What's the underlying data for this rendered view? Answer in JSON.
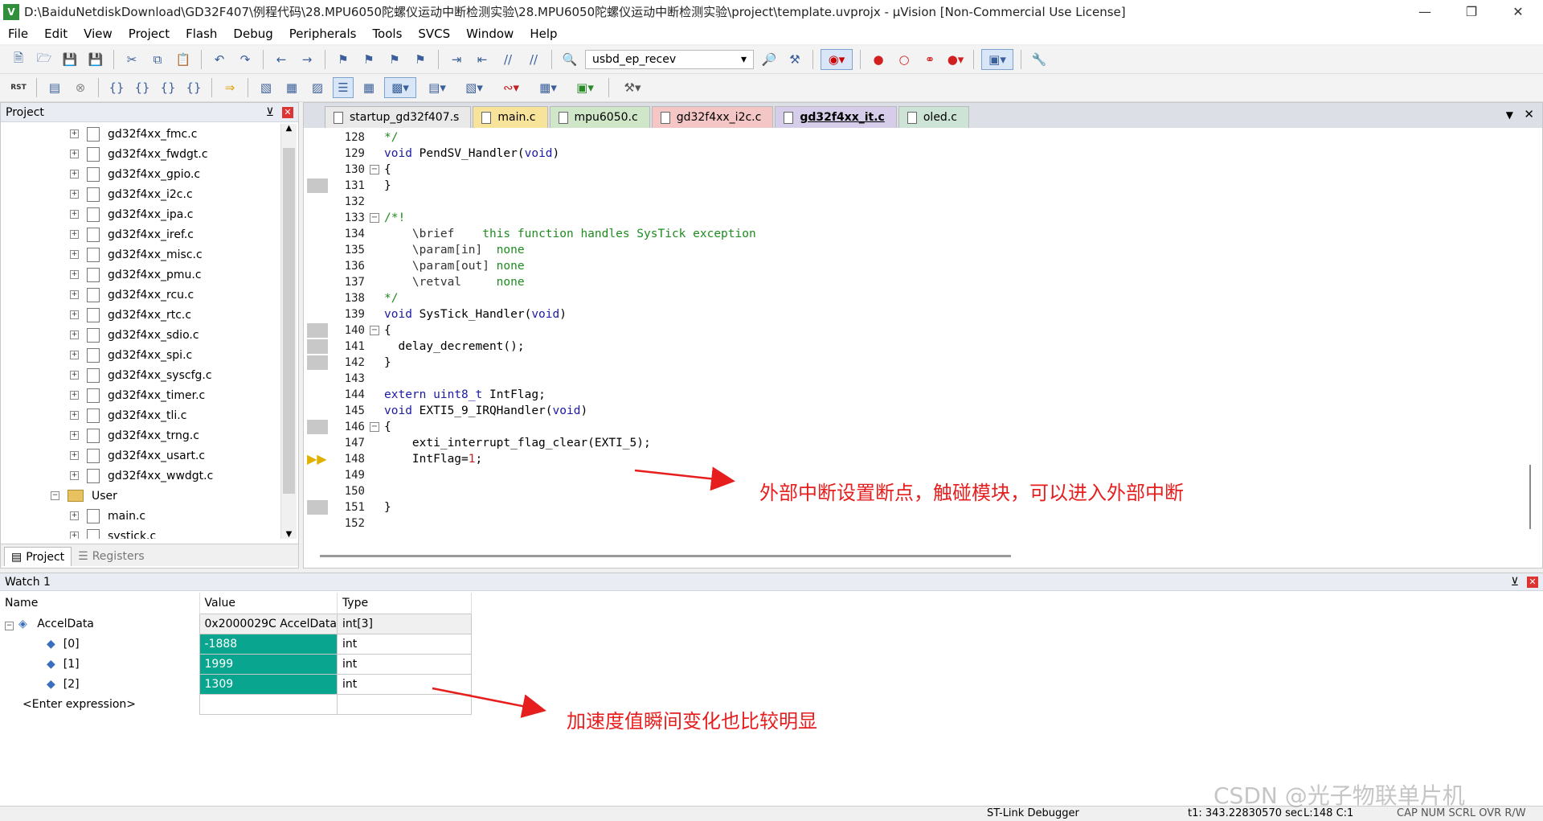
{
  "window": {
    "title": "D:\\BaiduNetdiskDownload\\GD32F407\\例程代码\\28.MPU6050陀螺仪运动中断检测实验\\28.MPU6050陀螺仪运动中断检测实验\\project\\template.uvprojx - µVision  [Non-Commercial Use License]",
    "logo": "V"
  },
  "menu": [
    "File",
    "Edit",
    "View",
    "Project",
    "Flash",
    "Debug",
    "Peripherals",
    "Tools",
    "SVCS",
    "Window",
    "Help"
  ],
  "toolbar": {
    "target_combo": "usbd_ep_recev",
    "rst_label": "RST"
  },
  "project_panel": {
    "title": "Project",
    "files": [
      "gd32f4xx_fmc.c",
      "gd32f4xx_fwdgt.c",
      "gd32f4xx_gpio.c",
      "gd32f4xx_i2c.c",
      "gd32f4xx_ipa.c",
      "gd32f4xx_iref.c",
      "gd32f4xx_misc.c",
      "gd32f4xx_pmu.c",
      "gd32f4xx_rcu.c",
      "gd32f4xx_rtc.c",
      "gd32f4xx_sdio.c",
      "gd32f4xx_spi.c",
      "gd32f4xx_syscfg.c",
      "gd32f4xx_timer.c",
      "gd32f4xx_tli.c",
      "gd32f4xx_trng.c",
      "gd32f4xx_usart.c",
      "gd32f4xx_wwdgt.c"
    ],
    "folder": "User",
    "user_files": [
      "main.c",
      "systick.c"
    ],
    "tabs": [
      "Project",
      "Registers"
    ]
  },
  "editor": {
    "tabs": [
      {
        "label": "startup_gd32f407.s",
        "color": "#e9e9e9"
      },
      {
        "label": "main.c",
        "color": "#f7e39a"
      },
      {
        "label": "mpu6050.c",
        "color": "#cfe6c8"
      },
      {
        "label": "gd32f4xx_i2c.c",
        "color": "#f4c6c6"
      },
      {
        "label": "gd32f4xx_it.c",
        "color": "#d6cdea"
      },
      {
        "label": "oled.c",
        "color": "#cce3d6"
      }
    ],
    "active_tab": "gd32f4xx_it.c",
    "lines": [
      {
        "n": "128",
        "t": "*/"
      },
      {
        "n": "129",
        "t": "void PendSV_Handler(void)"
      },
      {
        "n": "130",
        "t": "{"
      },
      {
        "n": "131",
        "t": "}"
      },
      {
        "n": "132",
        "t": ""
      },
      {
        "n": "133",
        "t": "/*!"
      },
      {
        "n": "134",
        "t": "    \\brief    this function handles SysTick exception"
      },
      {
        "n": "135",
        "t": "    \\param[in]  none"
      },
      {
        "n": "136",
        "t": "    \\param[out] none"
      },
      {
        "n": "137",
        "t": "    \\retval     none"
      },
      {
        "n": "138",
        "t": "*/"
      },
      {
        "n": "139",
        "t": "void SysTick_Handler(void)"
      },
      {
        "n": "140",
        "t": "{"
      },
      {
        "n": "141",
        "t": "  delay_decrement();"
      },
      {
        "n": "142",
        "t": "}"
      },
      {
        "n": "143",
        "t": ""
      },
      {
        "n": "144",
        "t": "extern uint8_t IntFlag;"
      },
      {
        "n": "145",
        "t": "void EXTI5_9_IRQHandler(void)"
      },
      {
        "n": "146",
        "t": "{"
      },
      {
        "n": "147",
        "t": "    exti_interrupt_flag_clear(EXTI_5);"
      },
      {
        "n": "148",
        "t": "    IntFlag=1;"
      },
      {
        "n": "149",
        "t": ""
      },
      {
        "n": "150",
        "t": ""
      },
      {
        "n": "151",
        "t": "}"
      },
      {
        "n": "152",
        "t": ""
      }
    ]
  },
  "watch": {
    "title": "Watch 1",
    "columns": [
      "Name",
      "Value",
      "Type"
    ],
    "rows": [
      {
        "name": "AccelData",
        "value": "0x2000029C AccelData",
        "type": "int[3]"
      },
      {
        "name": "[0]",
        "value": "-1888",
        "type": "int"
      },
      {
        "name": "[1]",
        "value": "1999",
        "type": "int"
      },
      {
        "name": "[2]",
        "value": "1309",
        "type": "int"
      }
    ],
    "enter_expression": "<Enter expression>"
  },
  "annotations": {
    "breakpoint_note": "外部中断设置断点，触碰模块，可以进入外部中断",
    "accel_note": "加速度值瞬间变化也比较明显",
    "color": "#e61e1e"
  },
  "status": {
    "debugger": "ST-Link Debugger",
    "time": "t1: 343.22830570 sec",
    "position": "L:148 C:1",
    "keys": "CAP  NUM  SCRL  OVR  R/W"
  },
  "watermark": "CSDN @光子物联单片机"
}
